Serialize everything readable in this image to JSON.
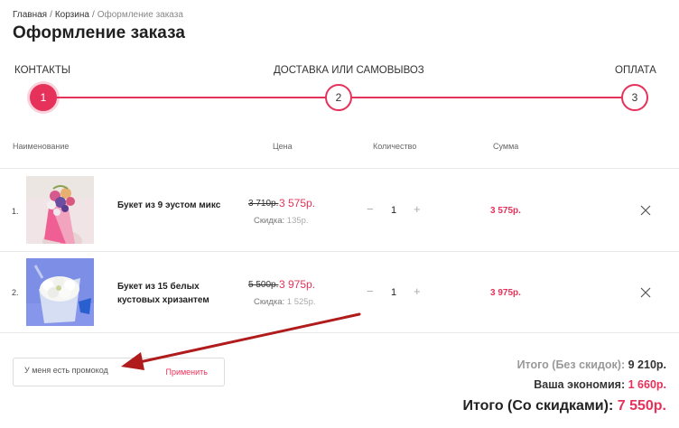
{
  "breadcrumb": {
    "home": "Главная",
    "cart": "Корзина",
    "current": "Оформление заказа",
    "separator": "/"
  },
  "page_title": "Оформление заказа",
  "steps": [
    {
      "label": "КОНТАКТЫ",
      "number": "1",
      "active": true
    },
    {
      "label": "ДОСТАВКА ИЛИ САМОВЫВОЗ",
      "number": "2",
      "active": false
    },
    {
      "label": "ОПЛАТА",
      "number": "3",
      "active": false
    }
  ],
  "table": {
    "headers": {
      "name": "Наименование",
      "price": "Цена",
      "quantity": "Количество",
      "sum": "Сумма"
    },
    "rows": [
      {
        "num": "1.",
        "name": "Букет из 9 эустом микс",
        "old_price": "3 710р.",
        "new_price": "3 575р.",
        "discount_label": "Скидка:",
        "discount_value": "135р.",
        "qty_minus": "−",
        "qty": "1",
        "qty_plus": "+",
        "sum": "3 575р."
      },
      {
        "num": "2.",
        "name": "Букет из 15 белых кустовых хризантем",
        "old_price": "5 500р.",
        "new_price": "3 975р.",
        "discount_label": "Скидка:",
        "discount_value": "1 525р.",
        "qty_minus": "−",
        "qty": "1",
        "qty_plus": "+",
        "sum": "3 975р."
      }
    ]
  },
  "promo": {
    "placeholder": "У меня есть промокод",
    "apply": "Применить"
  },
  "totals": {
    "without_discount_label": "Итого (Без скидок):",
    "without_discount_value": "9 210р.",
    "savings_label": "Ваша экономия:",
    "savings_value": "1 660р.",
    "with_discount_label": "Итого (Со скидками):",
    "with_discount_value": "7 550р."
  },
  "colors": {
    "accent": "#e6325a",
    "annotation_arrow": "#b01c1c"
  },
  "icons": [
    "close-icon",
    "annotation-arrow"
  ]
}
